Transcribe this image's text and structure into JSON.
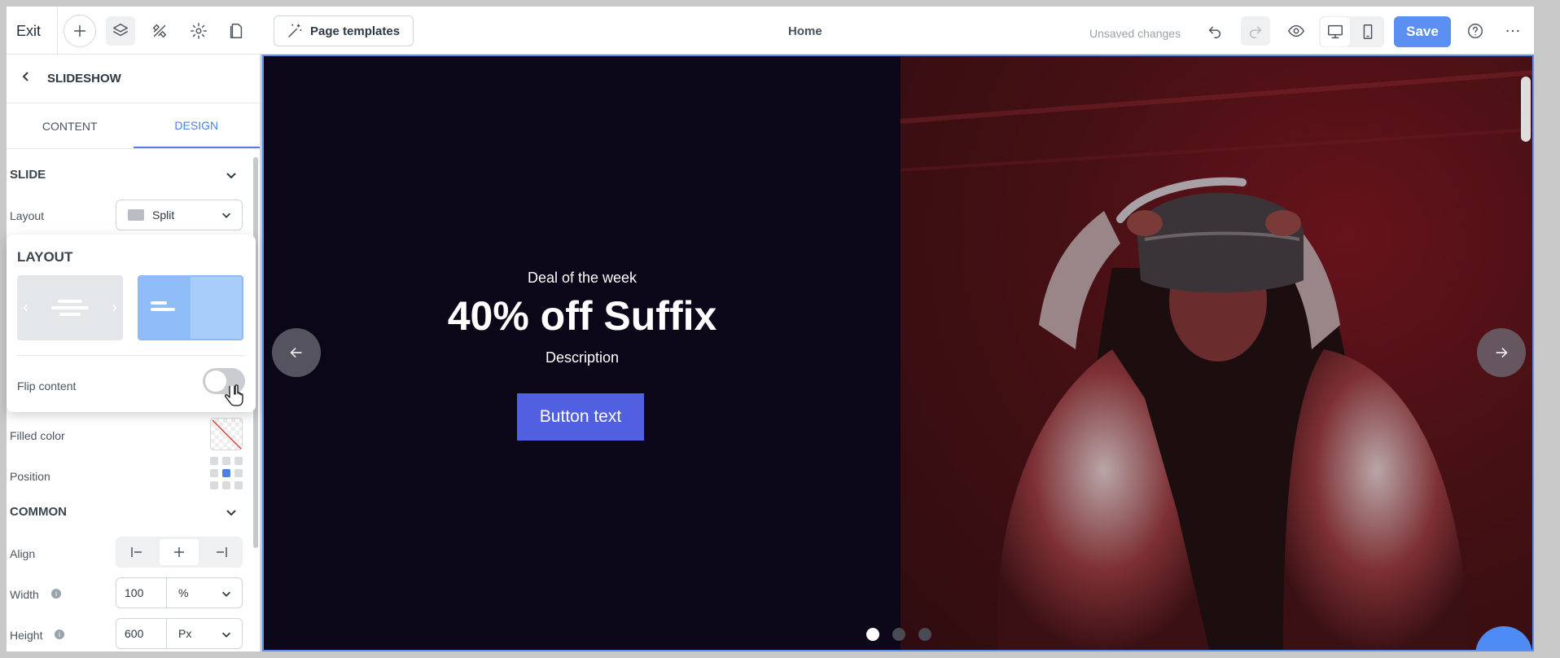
{
  "topbar": {
    "exit_label": "Exit",
    "templates_label": "Page templates",
    "page_title": "Home",
    "unsaved_label": "Unsaved changes",
    "save_label": "Save"
  },
  "panel": {
    "title": "SLIDESHOW",
    "tabs": [
      {
        "label": "CONTENT",
        "active": false
      },
      {
        "label": "DESIGN",
        "active": true
      }
    ],
    "slide_section": "SLIDE",
    "layout_label": "Layout",
    "layout_value": "Split",
    "filled_color_label": "Filled color",
    "position_label": "Position",
    "common_section": "COMMON",
    "align_label": "Align",
    "width_label": "Width",
    "width_value": "100",
    "width_unit": "%",
    "height_label": "Height",
    "height_value": "600",
    "height_unit": "Px"
  },
  "popover": {
    "title": "LAYOUT",
    "flip_label": "Flip content",
    "flip_on": false
  },
  "slide": {
    "deal_text": "Deal of the week",
    "headline": "40% off Suffix",
    "description": "Description",
    "button_text": "Button text",
    "dots": 3,
    "active_dot": 0
  },
  "colors": {
    "accent": "#5b8ff2",
    "cta": "#5060e0",
    "slide_bg": "#0c0619"
  }
}
